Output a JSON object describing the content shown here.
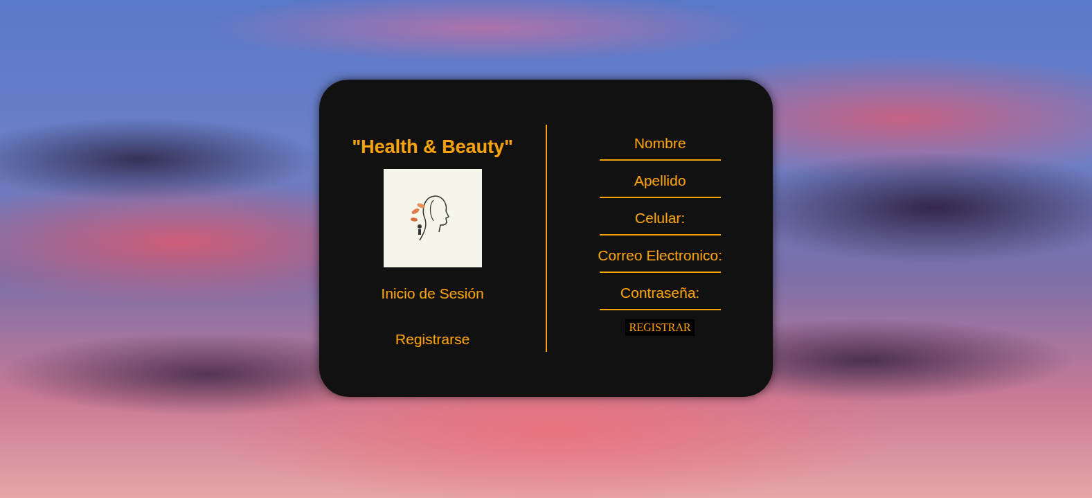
{
  "brand": {
    "title": "\"Health & Beauty\""
  },
  "nav": [
    {
      "label": "Inicio de Sesión"
    },
    {
      "label": "Registrarse"
    }
  ],
  "form": {
    "fields": [
      {
        "label": "Nombre"
      },
      {
        "label": "Apellido"
      },
      {
        "label": "Celular:"
      },
      {
        "label": "Correo Electronico:"
      },
      {
        "label": "Contraseña:"
      }
    ],
    "submit": "REGISTRAR"
  }
}
